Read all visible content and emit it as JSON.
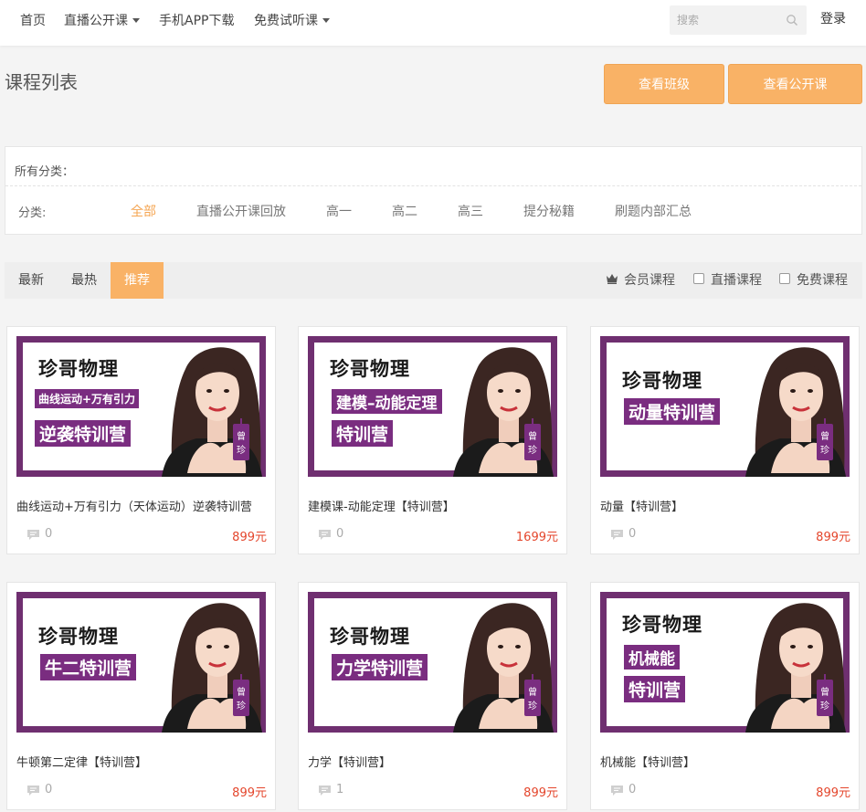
{
  "nav": {
    "items": [
      {
        "label": "首页",
        "dropdown": false
      },
      {
        "label": "直播公开课",
        "dropdown": true
      },
      {
        "label": "手机APP下载",
        "dropdown": false
      },
      {
        "label": "免费试听课",
        "dropdown": true
      }
    ],
    "search_placeholder": "搜索",
    "login_label": "登录"
  },
  "page": {
    "title": "课程列表",
    "view_class_button": "查看班级",
    "view_public_button": "查看公开课"
  },
  "categories": {
    "header": "所有分类：",
    "label": "分类:",
    "items": [
      "全部",
      "直播公开课回放",
      "高一",
      "高二",
      "高三",
      "提分秘籍",
      "刷题内部汇总"
    ],
    "active": "全部"
  },
  "sort": {
    "tabs": [
      "最新",
      "最热",
      "推荐"
    ],
    "active": "推荐",
    "filters": {
      "member": "会员课程",
      "live": "直播课程",
      "free": "免费课程"
    }
  },
  "colors": {
    "accent": "#f9b266",
    "price": "#e4462c",
    "thumb_purple": "#6f2f70"
  },
  "courses": [
    {
      "title": "曲线运动+万有引力（天体运动）逆袭特训营",
      "comments": "0",
      "price": "899元",
      "thumb_brand": "珍哥物理",
      "thumb_sub": "曲线运动+万有引力",
      "thumb_main": "逆袭特训营",
      "badge": "曾珍"
    },
    {
      "title": "建模课-动能定理【特训营】",
      "comments": "0",
      "price": "1699元",
      "thumb_brand": "珍哥物理",
      "thumb_sub": "建模–动能定理",
      "thumb_main": "特训营",
      "badge": "曾珍"
    },
    {
      "title": "动量【特训营】",
      "comments": "0",
      "price": "899元",
      "thumb_brand": "珍哥物理",
      "thumb_sub": "",
      "thumb_main": "动量特训营",
      "badge": "曾珍"
    },
    {
      "title": "牛顿第二定律【特训营】",
      "comments": "0",
      "price": "899元",
      "thumb_brand": "珍哥物理",
      "thumb_sub": "",
      "thumb_main": "牛二特训营",
      "badge": "曾珍"
    },
    {
      "title": "力学【特训营】",
      "comments": "1",
      "price": "899元",
      "thumb_brand": "珍哥物理",
      "thumb_sub": "",
      "thumb_main": "力学特训营",
      "badge": "曾珍"
    },
    {
      "title": "机械能【特训营】",
      "comments": "0",
      "price": "899元",
      "thumb_brand": "珍哥物理",
      "thumb_sub": "机械能",
      "thumb_main": "特训营",
      "badge": "曾珍"
    }
  ]
}
